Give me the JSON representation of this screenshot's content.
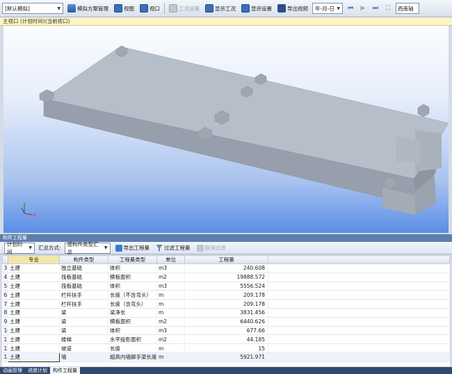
{
  "toolbar": {
    "scheme_combo": "[默认模拟]",
    "sim_scheme_manage": "模拟方案管理",
    "view_label": "视图",
    "viewport_label": "视口",
    "work_settings": "工况设置",
    "show_work": "显示工况",
    "display_settings": "显示设置",
    "export_video": "导出视频",
    "date_format_combo": "年-月-日",
    "view_direction": "西南轴"
  },
  "viewport": {
    "title": "主视口 (计划时间)(当前视口)"
  },
  "panel": {
    "title": "构件工程量",
    "time_combo": "计划时间",
    "summary_label": "汇总方式:",
    "summary_combo": "按构件类型汇总",
    "export_btn": "导出工程量",
    "filter_btn": "过滤工程量",
    "cancel_filter_btn": "取消过滤"
  },
  "table": {
    "headers": [
      "专业",
      "构件类型",
      "工程量类型",
      "单位",
      "工程量"
    ],
    "rows": [
      {
        "idx": "3",
        "major": "土建",
        "type": "独立基础",
        "qtype": "体积",
        "unit": "m3",
        "qty": "240.608"
      },
      {
        "idx": "4",
        "major": "土建",
        "type": "筏板基础",
        "qtype": "模板面积",
        "unit": "m2",
        "qty": "19888.572"
      },
      {
        "idx": "5",
        "major": "土建",
        "type": "筏板基础",
        "qtype": "体积",
        "unit": "m3",
        "qty": "5556.524"
      },
      {
        "idx": "6",
        "major": "土建",
        "type": "栏杆扶手",
        "qtype": "长度（不含弯头）",
        "unit": "m",
        "qty": "209.178"
      },
      {
        "idx": "7",
        "major": "土建",
        "type": "栏杆扶手",
        "qtype": "长度（含弯头）",
        "unit": "m",
        "qty": "209.178"
      },
      {
        "idx": "8",
        "major": "土建",
        "type": "梁",
        "qtype": "梁净长",
        "unit": "m",
        "qty": "3831.456"
      },
      {
        "idx": "9",
        "major": "土建",
        "type": "梁",
        "qtype": "模板面积",
        "unit": "m2",
        "qty": "6440.626"
      },
      {
        "idx": "10",
        "major": "土建",
        "type": "梁",
        "qtype": "体积",
        "unit": "m3",
        "qty": "677.66"
      },
      {
        "idx": "11",
        "major": "土建",
        "type": "楼梯",
        "qtype": "水平投影面积",
        "unit": "m2",
        "qty": "44.185"
      },
      {
        "idx": "12",
        "major": "土建",
        "type": "坡道",
        "qtype": "长度",
        "unit": "m",
        "qty": "15"
      },
      {
        "idx": "13",
        "major": "土建",
        "type": "墙",
        "qtype": "超高内墙脚手架长度",
        "unit": "m",
        "qty": "5921.971"
      }
    ]
  },
  "tabs": [
    "动画管理",
    "进度计划",
    "构件工程量"
  ]
}
